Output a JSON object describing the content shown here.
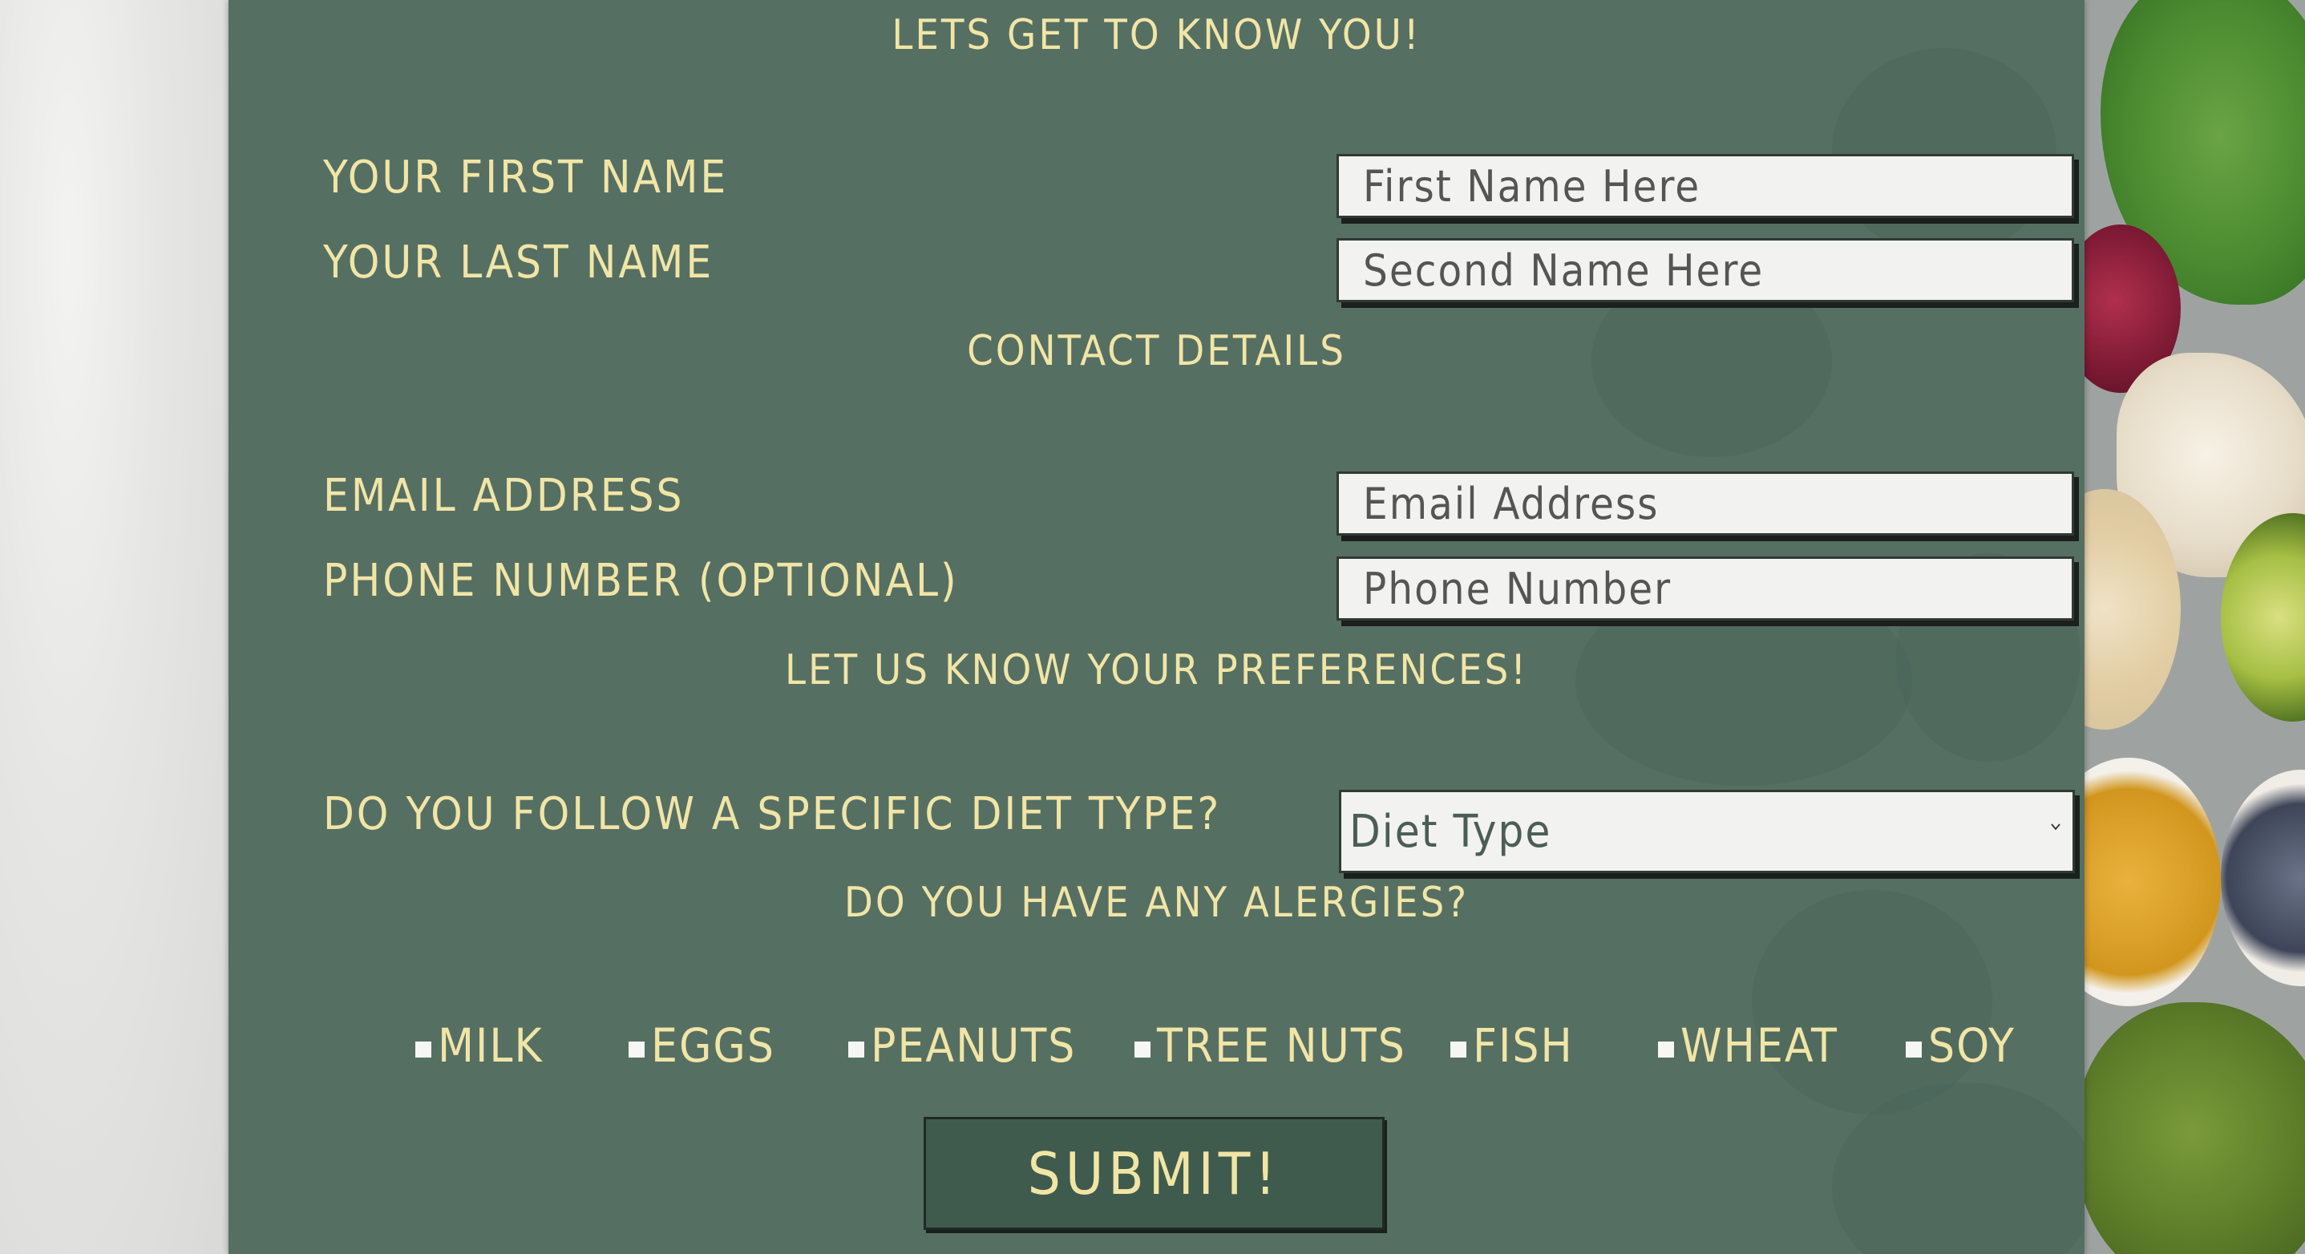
{
  "form": {
    "heading": "LETS GET TO KNOW YOU!",
    "first_name": {
      "label": "YOUR FIRST NAME",
      "placeholder": "First Name Here"
    },
    "last_name": {
      "label": "YOUR LAST NAME",
      "placeholder": "Second Name Here"
    },
    "contact_heading": "CONTACT DETAILS",
    "email": {
      "label": "EMAIL ADDRESS",
      "placeholder": "Email Address"
    },
    "phone": {
      "label": "PHONE NUMBER (OPTIONAL)",
      "placeholder": "Phone Number"
    },
    "preferences_heading": "LET US KNOW YOUR PREFERENCES!",
    "diet": {
      "label": "DO YOU FOLLOW A SPECIFIC DIET TYPE?",
      "selected": "Diet Type"
    },
    "allergies_heading": "DO YOU HAVE ANY ALERGIES?",
    "allergies": [
      "MILK",
      "EGGS",
      "PEANUTS",
      "TREE NUTS",
      "FISH",
      "WHEAT",
      "SOY"
    ],
    "submit_label": "SUBMIT!"
  },
  "colors": {
    "panel": "#566f63",
    "accent_text": "#f1e5a6",
    "button": "#3f5b4e",
    "field_bg": "#f2f2f0"
  },
  "icons": {
    "select_arrow": "chevron-down-icon"
  }
}
